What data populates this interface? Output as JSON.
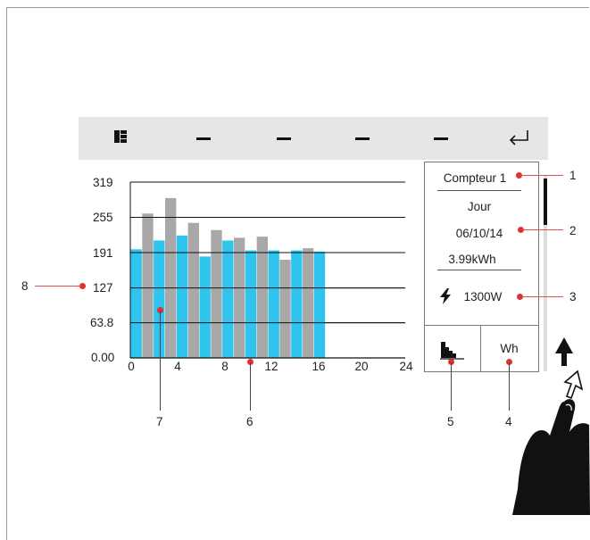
{
  "toolbar": {
    "icons": [
      "grid-icon",
      "minus-icon",
      "minus-icon",
      "minus-icon",
      "minus-icon",
      "return-icon"
    ]
  },
  "chart_data": {
    "type": "bar",
    "x": [
      0,
      1,
      2,
      3,
      4,
      5,
      6,
      7,
      8,
      9,
      10,
      11,
      12,
      13,
      14,
      15,
      16
    ],
    "series": [
      {
        "values": [
          197,
          213,
          222,
          184,
          213,
          195,
          195,
          195,
          193
        ]
      },
      {
        "values": [
          262,
          290,
          245,
          232,
          218,
          220,
          178,
          199
        ]
      }
    ],
    "y_ticks": [
      "319",
      "255",
      "191",
      "127",
      "63.8",
      "0.00"
    ],
    "x_ticks": [
      "0",
      "4",
      "8",
      "12",
      "16",
      "20",
      "24"
    ],
    "ylim": [
      0,
      319
    ],
    "xlim": [
      0,
      24
    ],
    "grid": true,
    "colors": {
      "current": "#2ec4ee",
      "previous": "#a8a8a8"
    }
  },
  "panel": {
    "meter": "Compteur 1",
    "period": "Jour",
    "date": "06/10/14",
    "energy": "3.99kWh",
    "power": "1300W",
    "unit_button": "Wh"
  },
  "callouts": [
    "1",
    "2",
    "3",
    "4",
    "5",
    "6",
    "7",
    "8"
  ]
}
